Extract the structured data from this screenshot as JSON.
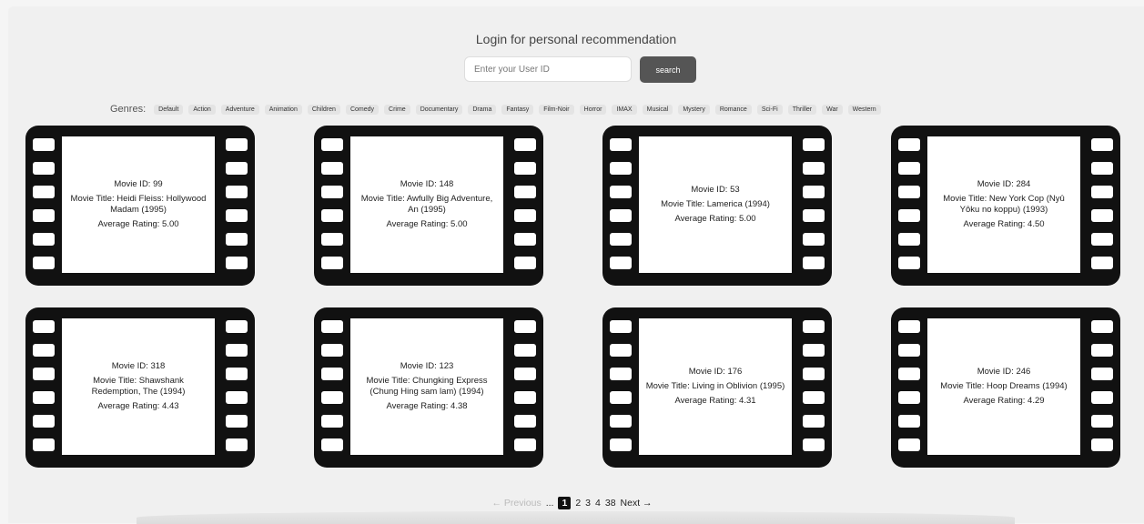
{
  "login": {
    "title": "Login for personal recommendation",
    "placeholder": "Enter your User ID",
    "search_label": "search"
  },
  "genres": {
    "label": "Genres:",
    "items": [
      "Default",
      "Action",
      "Adventure",
      "Animation",
      "Children",
      "Comedy",
      "Crime",
      "Documentary",
      "Drama",
      "Fantasy",
      "Film-Noir",
      "Horror",
      "IMAX",
      "Musical",
      "Mystery",
      "Romance",
      "Sci-Fi",
      "Thriller",
      "War",
      "Western"
    ]
  },
  "movies": [
    {
      "id": "Movie ID: 99",
      "title": "Movie Title: Heidi Fleiss: Hollywood Madam (1995)",
      "rating": "Average Rating: 5.00"
    },
    {
      "id": "Movie ID: 148",
      "title": "Movie Title: Awfully Big Adventure, An (1995)",
      "rating": "Average Rating: 5.00"
    },
    {
      "id": "Movie ID: 53",
      "title": "Movie Title: Lamerica (1994)",
      "rating": "Average Rating: 5.00"
    },
    {
      "id": "Movie ID: 284",
      "title": "Movie Title: New York Cop (Nyû Yôku no koppu) (1993)",
      "rating": "Average Rating: 4.50"
    },
    {
      "id": "Movie ID: 318",
      "title": "Movie Title: Shawshank Redemption, The (1994)",
      "rating": "Average Rating: 4.43"
    },
    {
      "id": "Movie ID: 123",
      "title": "Movie Title: Chungking Express (Chung Hing sam lam) (1994)",
      "rating": "Average Rating: 4.38"
    },
    {
      "id": "Movie ID: 176",
      "title": "Movie Title: Living in Oblivion (1995)",
      "rating": "Average Rating: 4.31"
    },
    {
      "id": "Movie ID: 246",
      "title": "Movie Title: Hoop Dreams (1994)",
      "rating": "Average Rating: 4.29"
    }
  ],
  "pagination": {
    "previous": "← Previous",
    "ellipsis": "...",
    "current": "1",
    "pages": [
      "2",
      "3",
      "4",
      "38"
    ],
    "next": "Next →"
  }
}
